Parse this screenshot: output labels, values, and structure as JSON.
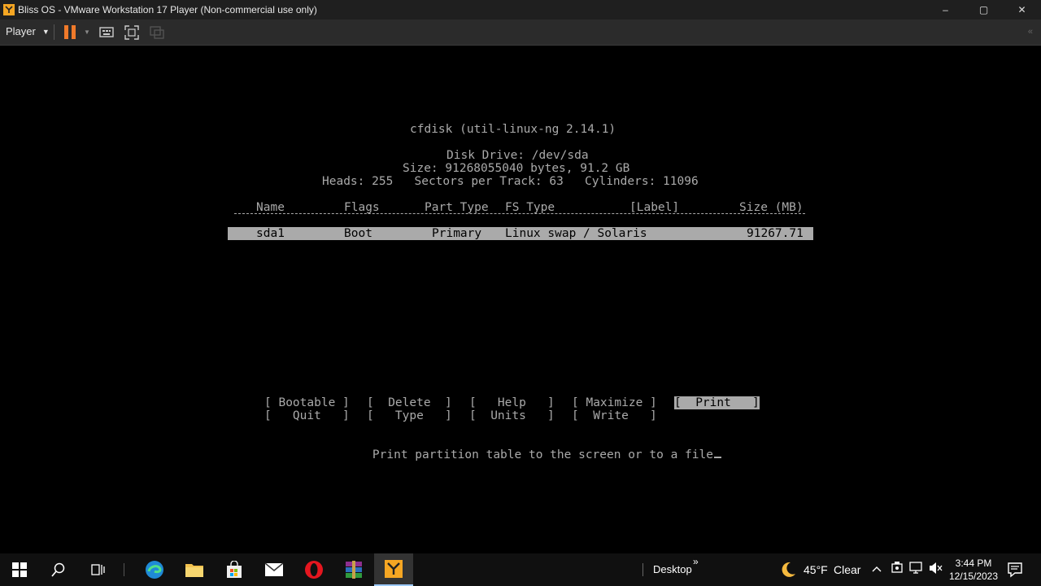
{
  "window": {
    "title": "Bliss OS - VMware Workstation 17 Player (Non-commercial use only)",
    "minimize_glyph": "–",
    "maximize_glyph": "▢",
    "close_glyph": "✕"
  },
  "toolbar": {
    "player_label": "Player",
    "icons": [
      "pause-icon",
      "send-ctrl-alt-del-icon",
      "fullscreen-icon",
      "unity-icon",
      "collapse-toolbar-icon"
    ]
  },
  "cfdisk": {
    "title": "cfdisk (util-linux-ng 2.14.1)",
    "disk_drive": "Disk Drive: /dev/sda",
    "size_line": "Size: 91268055040 bytes, 91.2 GB",
    "geometry_line": "Heads: 255   Sectors per Track: 63   Cylinders: 11096",
    "columns": {
      "name": "Name",
      "flags": "Flags",
      "part_type": "Part Type",
      "fs_type": "FS Type",
      "label": "[Label]",
      "size": "Size (MB)"
    },
    "rows": [
      {
        "name": "sda1",
        "flags": "Boot",
        "part_type": "Primary",
        "fs_type": "Linux swap / Solaris",
        "label": "",
        "size": "91267.71"
      }
    ],
    "menu_row1": {
      "bootable": "[ Bootable ]",
      "delete": "[  Delete  ]",
      "help": "[   Help   ]",
      "maximize": "[ Maximize ]",
      "print": "[  Print   ]"
    },
    "menu_row2": {
      "quit": "[   Quit   ]",
      "type": "[   Type   ]",
      "units": "[  Units   ]",
      "write": "[  Write   ]"
    },
    "selected_menu": "print",
    "status": "Print partition table to the screen or to a file"
  },
  "taskbar": {
    "apps": [
      "windows-start-icon",
      "search-icon",
      "task-view-icon",
      "edge-icon",
      "file-explorer-icon",
      "store-icon",
      "mail-icon",
      "opera-icon",
      "winrar-icon",
      "vmware-player-icon"
    ],
    "desktop_label": "Desktop",
    "chevron": "»",
    "weather_temp": "45°F",
    "weather_desc": "Clear",
    "tray_up": "^",
    "time": "3:44 PM",
    "date": "12/15/2023"
  },
  "colors": {
    "console_text": "#aaaaaa",
    "console_bg": "#000000",
    "selection_bg": "#aaaaaa",
    "pause_accent": "#f07a2a",
    "taskbar_bg": "#101010"
  }
}
